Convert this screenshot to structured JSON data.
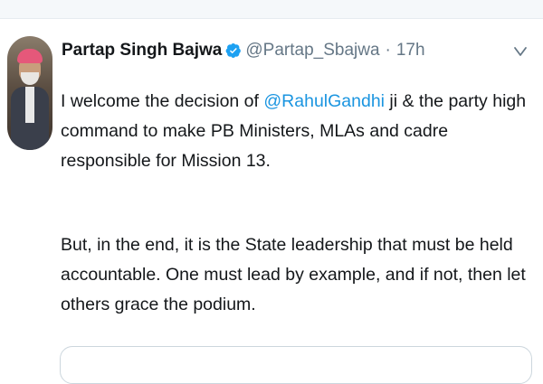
{
  "tweet": {
    "author_name": "Partap Singh Bajwa",
    "handle": "@Partap_Sbajwa",
    "separator": "·",
    "time": "17h",
    "verified_icon": "verified-badge-icon",
    "menu_icon": "chevron-down-icon",
    "para1_before": "I welcome the decision of ",
    "para1_mention": "@RahulGandhi",
    "para1_after": " ji & the party high command to make PB Ministers, MLAs and cadre responsible for Mission 13.",
    "para2": "But, in the end, it is the State leadership that must be held accountable. One must lead by example, and if not, then let others grace the podium."
  },
  "colors": {
    "mention": "#1b95e0",
    "verified": "#1da1f2",
    "meta_text": "#657786",
    "body_text": "#14171a"
  }
}
